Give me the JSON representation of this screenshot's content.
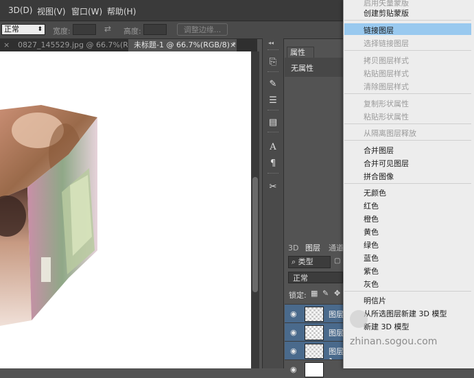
{
  "menubar": {
    "items": [
      "3D(D)",
      "视图(V)",
      "窗口(W)",
      "帮助(H)"
    ]
  },
  "options": {
    "blend_mode": "正常",
    "width_label": "宽度:",
    "height_label": "高度:",
    "refine_edge": "调整边缘..."
  },
  "tabs": [
    {
      "label": "0827_145529.jpg @ 66.7%(R..."
    },
    {
      "label": "未标题-1 @ 66.7%(RGB/8) *"
    }
  ],
  "properties": {
    "tab": "属性",
    "value": "无属性"
  },
  "layers": {
    "tabs": [
      "3D",
      "图层",
      "通道"
    ],
    "filter": "类型",
    "blend": "正常",
    "lock_label": "锁定:",
    "rows": [
      "图层",
      "图层",
      "图层 1"
    ]
  },
  "context_menu": {
    "items": [
      {
        "label": "启用矢量蒙版",
        "disabled": true
      },
      {
        "label": "创建剪贴蒙版",
        "disabled": false
      },
      {
        "label": "链接图层",
        "disabled": false,
        "highlighted": true
      },
      {
        "label": "选择链接图层",
        "disabled": true
      },
      {
        "label": "拷贝图层样式",
        "disabled": true
      },
      {
        "label": "粘贴图层样式",
        "disabled": true
      },
      {
        "label": "清除图层样式",
        "disabled": true
      },
      {
        "label": "复制形状属性",
        "disabled": true
      },
      {
        "label": "粘贴形状属性",
        "disabled": true
      },
      {
        "label": "从隔离图层释放",
        "disabled": true
      },
      {
        "label": "合并图层",
        "disabled": false
      },
      {
        "label": "合并可见图层",
        "disabled": false
      },
      {
        "label": "拼合图像",
        "disabled": false
      },
      {
        "label": "无颜色",
        "disabled": false
      },
      {
        "label": "红色",
        "disabled": false
      },
      {
        "label": "橙色",
        "disabled": false
      },
      {
        "label": "黄色",
        "disabled": false
      },
      {
        "label": "绿色",
        "disabled": false
      },
      {
        "label": "蓝色",
        "disabled": false
      },
      {
        "label": "紫色",
        "disabled": false
      },
      {
        "label": "灰色",
        "disabled": false
      },
      {
        "label": "明信片",
        "disabled": false
      },
      {
        "label": "从所选图层新建 3D 模型",
        "disabled": false
      },
      {
        "label": "新建 3D 模型",
        "disabled": false
      }
    ]
  },
  "watermark": {
    "text": "zhinan.sogou.com"
  },
  "colors": {
    "highlight": "#99c9ef",
    "layer_selected": "#4a6a8c"
  }
}
